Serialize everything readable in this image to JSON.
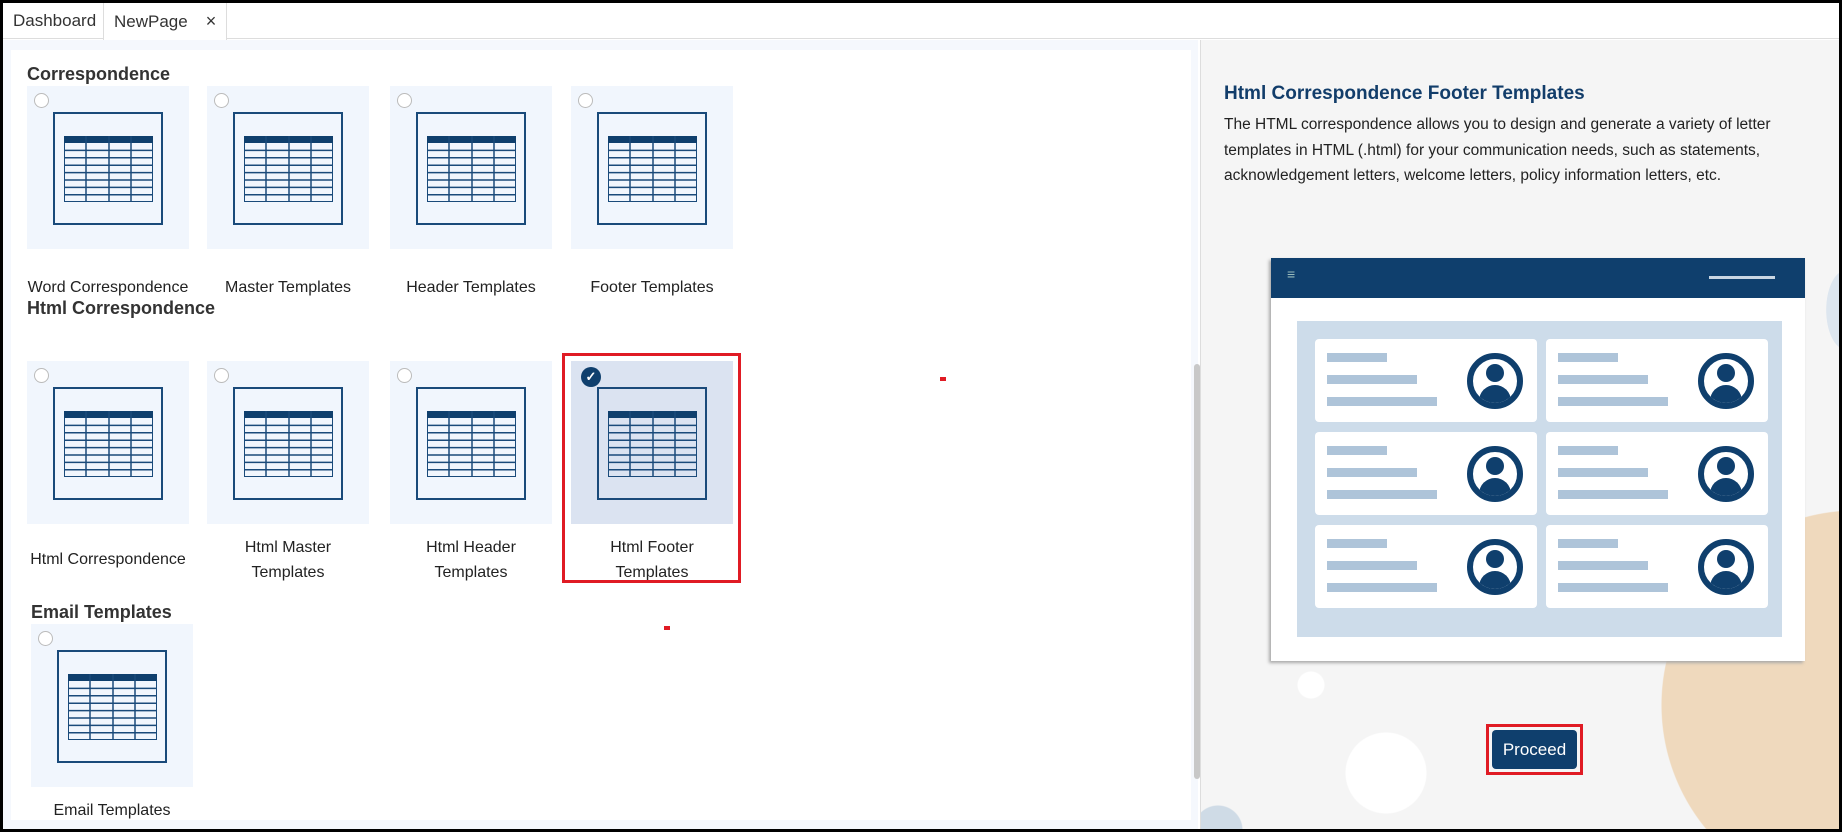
{
  "tabs": [
    {
      "label": "Dashboard"
    },
    {
      "label": "NewPage",
      "close": "×"
    }
  ],
  "sections": [
    {
      "title": "Correspondence",
      "items": [
        {
          "label": "Word Correspondence",
          "selected": false
        },
        {
          "label": "Master Templates",
          "selected": false
        },
        {
          "label": "Header Templates",
          "selected": false
        },
        {
          "label": "Footer Templates",
          "selected": false
        }
      ]
    },
    {
      "title": "Html Correspondence",
      "items": [
        {
          "label": "Html Correspondence",
          "selected": false
        },
        {
          "label": "Html Master Templates",
          "selected": false
        },
        {
          "label": "Html Header Templates",
          "selected": false
        },
        {
          "label": "Html Footer Templates",
          "selected": true
        }
      ]
    },
    {
      "title": "Email Templates",
      "items": [
        {
          "label": "Email Templates",
          "selected": false
        }
      ]
    }
  ],
  "detail": {
    "title": "Html Correspondence Footer Templates",
    "description": "The HTML correspondence allows you to design and generate a variety of letter templates in HTML (.html) for your communication needs, such as statements, acknowledgement letters, welcome letters, policy information letters, etc.",
    "menu_icon": "≡",
    "proceed_label": "Proceed"
  },
  "colors": {
    "primary": "#0f3f6d",
    "highlight": "#e01b24",
    "selected_bg": "#dbe3f1"
  }
}
